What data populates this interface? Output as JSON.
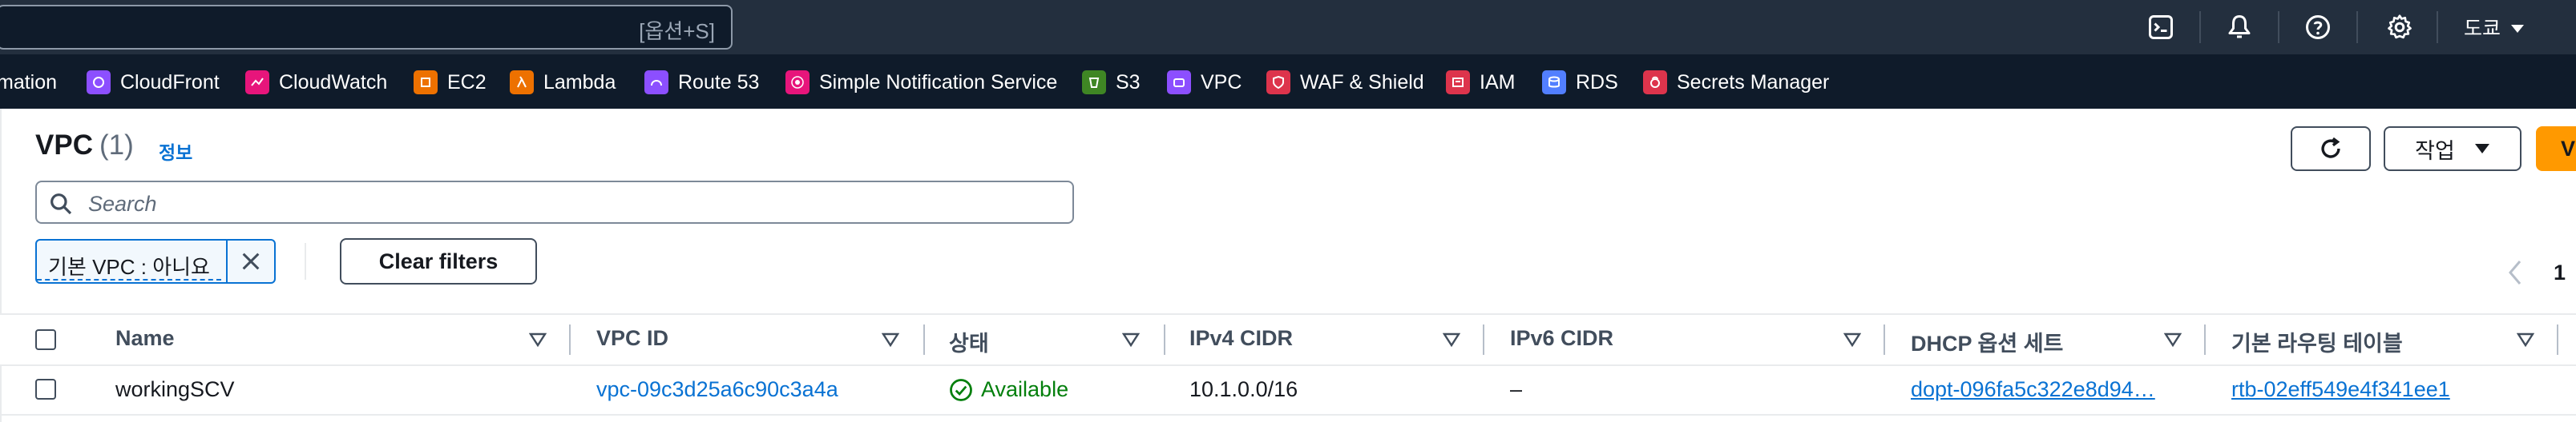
{
  "topbar": {
    "search_shortcut": "[옵션+S]",
    "region": "도쿄"
  },
  "services": [
    {
      "label": "mation",
      "color": "#e7157b"
    },
    {
      "label": "CloudFront",
      "color": "#8c4fff"
    },
    {
      "label": "CloudWatch",
      "color": "#e7157b"
    },
    {
      "label": "EC2",
      "color": "#ed7100"
    },
    {
      "label": "Lambda",
      "color": "#ed7100"
    },
    {
      "label": "Route 53",
      "color": "#8c4fff"
    },
    {
      "label": "Simple Notification Service",
      "color": "#e7157b"
    },
    {
      "label": "S3",
      "color": "#3f8624"
    },
    {
      "label": "VPC",
      "color": "#8c4fff"
    },
    {
      "label": "WAF & Shield",
      "color": "#dd344c"
    },
    {
      "label": "IAM",
      "color": "#dd344c"
    },
    {
      "label": "RDS",
      "color": "#527fff"
    },
    {
      "label": "Secrets Manager",
      "color": "#dd344c"
    }
  ],
  "header": {
    "title": "VPC",
    "count": "(1)",
    "info": "정보",
    "actions_label": "작업",
    "primary_label": "V"
  },
  "filter": {
    "placeholder": "Search",
    "token": "기본 VPC : 아니요",
    "clear_label": "Clear filters"
  },
  "pagination": {
    "current_page": "1"
  },
  "table": {
    "columns": [
      "Name",
      "VPC ID",
      "상태",
      "IPv4 CIDR",
      "IPv6 CIDR",
      "DHCP 옵션 세트",
      "기본 라우팅 테이블"
    ],
    "rows": [
      {
        "name": "workingSCV",
        "vpc_id": "vpc-09c3d25a6c90c3a4a",
        "status": "Available",
        "ipv4": "10.1.0.0/16",
        "ipv6": "–",
        "dhcp": "dopt-096fa5c322e8d94…",
        "route_table": "rtb-02eff549e4f341ee1"
      }
    ]
  },
  "colors": {
    "topbar_bg": "#232f3e",
    "services_bg": "#0f1b2a",
    "link": "#0972d3",
    "success": "#037f0c",
    "primary": "#ff9900"
  }
}
